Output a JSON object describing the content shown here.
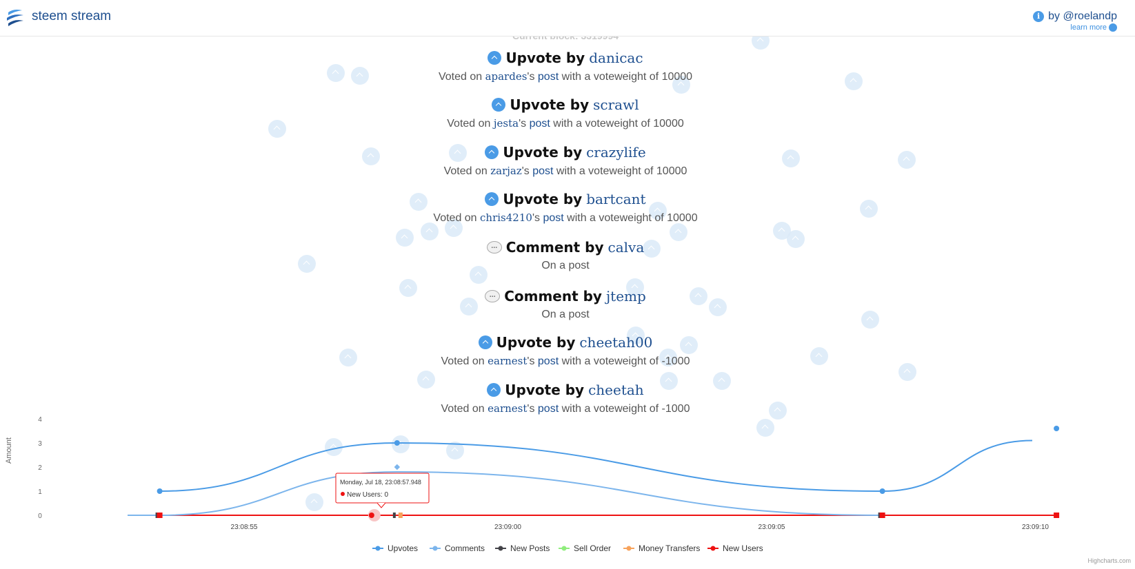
{
  "header": {
    "brand": "steem stream",
    "author": "by @roelandp",
    "learn_more": "learn more"
  },
  "stream": {
    "current_block": "Current block: 3319994",
    "events": [
      {
        "type": "upvote",
        "verb": "Upvote by",
        "user": "danicac",
        "pre": "Voted on ",
        "author": "apardes",
        "mid": "'s ",
        "post": "post",
        "post_text": " with a voteweight of 10000"
      },
      {
        "type": "upvote",
        "verb": "Upvote by",
        "user": "scrawl",
        "pre": "Voted on ",
        "author": "jesta",
        "mid": "'s ",
        "post": "post",
        "post_text": " with a voteweight of 10000"
      },
      {
        "type": "upvote",
        "verb": "Upvote by",
        "user": "crazylife",
        "pre": "Voted on ",
        "author": "zarjaz",
        "mid": "'s ",
        "post": "post",
        "post_text": " with a voteweight of 10000"
      },
      {
        "type": "upvote",
        "verb": "Upvote by",
        "user": "bartcant",
        "pre": "Voted on ",
        "author": "chris4210",
        "mid": "'s ",
        "post": "post",
        "post_text": " with a voteweight of 10000"
      },
      {
        "type": "comment",
        "verb": "Comment by",
        "user": "calva",
        "text": "On a post"
      },
      {
        "type": "comment",
        "verb": "Comment by",
        "user": "jtemp",
        "text": "On a post"
      },
      {
        "type": "upvote",
        "verb": "Upvote by",
        "user": "cheetah00",
        "pre": "Voted on ",
        "author": "earnest",
        "mid": "'s ",
        "post": "post",
        "post_text": " with a voteweight of -1000"
      },
      {
        "type": "upvote",
        "verb": "Upvote by",
        "user": "cheetah",
        "pre": "Voted on ",
        "author": "earnest",
        "mid": "'s ",
        "post": "post",
        "post_text": " with a voteweight of -1000"
      }
    ]
  },
  "colors": {
    "upvotes": "#4a9be6",
    "comments": "#7cb5ec",
    "new_posts": "#434348",
    "sell_order": "#90ed7d",
    "money_transfers": "#f7a35c",
    "new_users": "#ee1111"
  },
  "chart_data": {
    "type": "line",
    "ylabel": "Amount",
    "ylim": [
      0,
      4
    ],
    "yticks": [
      "0",
      "1",
      "2",
      "3",
      "4"
    ],
    "xticks": [
      "23:08:55",
      "23:09:00",
      "23:09:05",
      "23:09:10"
    ],
    "series": [
      {
        "name": "Upvotes",
        "points": [
          [
            "23:08:53.4",
            1
          ],
          [
            "23:08:57.9",
            3
          ],
          [
            "23:09:07.1",
            1
          ],
          [
            "23:09:10.4",
            3.6
          ]
        ]
      },
      {
        "name": "Comments",
        "points": [
          [
            "23:08:53.4",
            0
          ],
          [
            "23:08:57.9",
            2
          ],
          [
            "23:09:07.1",
            0
          ]
        ]
      },
      {
        "name": "New Posts",
        "points": [
          [
            "23:08:53.4",
            0
          ],
          [
            "23:08:57.9",
            0
          ],
          [
            "23:09:07.1",
            0
          ]
        ]
      },
      {
        "name": "Sell Order",
        "points": []
      },
      {
        "name": "Money Transfers",
        "points": [
          [
            "23:08:57.9",
            0
          ]
        ]
      },
      {
        "name": "New Users",
        "points": [
          [
            "23:08:53.4",
            0
          ],
          [
            "23:08:57.9",
            0
          ],
          [
            "23:09:07.1",
            0
          ],
          [
            "23:09:10.4",
            0
          ]
        ]
      }
    ],
    "tooltip": {
      "title": "Monday, Jul 18, 23:08:57.948",
      "label": "New Users: 0"
    },
    "credits": "Highcharts.com"
  }
}
